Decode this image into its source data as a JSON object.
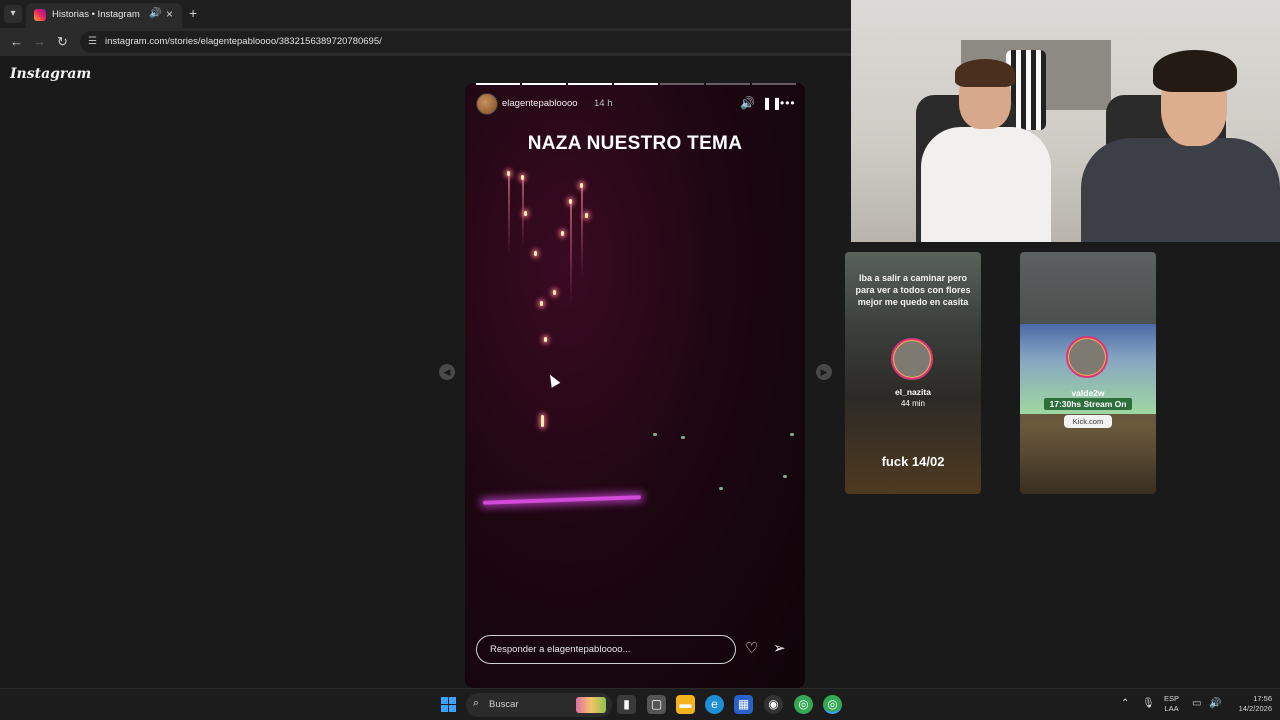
{
  "browser": {
    "tab_title": "Historias • Instagram",
    "url": "instagram.com/stories/elagentepabloooo/3832156389720780695/"
  },
  "icons": {
    "tab_list": "chevron-down-icon",
    "mute": "speaker-icon",
    "close": "close-icon",
    "new_tab": "plus-icon",
    "back": "back-arrow-icon",
    "forward": "forward-arrow-icon",
    "reload": "reload-icon",
    "site_info": "site-info-icon",
    "pause": "pause-icon",
    "more": "more-icon",
    "heart": "heart-icon",
    "send": "send-icon"
  },
  "instagram": {
    "logo": "Instagram",
    "story": {
      "username": "elagentepabloooo",
      "time_ago": "14 h",
      "text": "NAZA NUESTRO TEMA",
      "reply_placeholder": "Responder a elagentepabloooo...",
      "segments_total": 7,
      "segments_done": 4
    }
  },
  "stream_overlays": {
    "card1": {
      "caption": "Iba a salir a caminar pero para ver a todos con flores mejor me quedo en casita",
      "name": "el_nazita",
      "sub": "44 min",
      "big_text": "fuck 14/02"
    },
    "card2": {
      "name": "valde2w",
      "stream_text": "17:30hs Stream On",
      "link": "Kick.com"
    }
  },
  "taskbar": {
    "search_placeholder": "Buscar",
    "lang_top": "ESP",
    "lang_bottom": "LAA",
    "time": "17:56",
    "date": "14/2/2026"
  },
  "colors": {
    "accent_blue": "#3ba3ff",
    "neon_pink": "#d14bd8",
    "story_ring": "#e0337e"
  }
}
